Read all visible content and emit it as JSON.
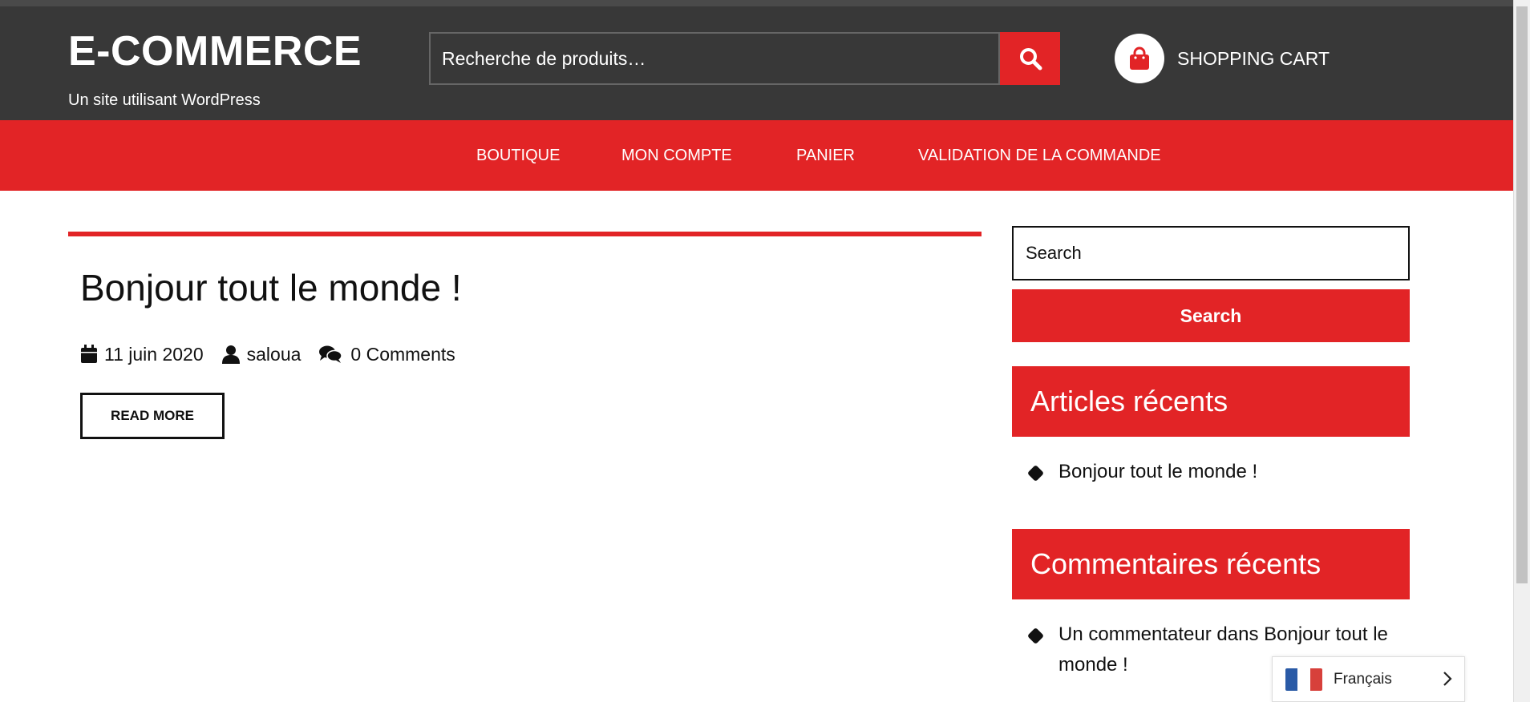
{
  "header": {
    "site_title": "E-COMMERCE",
    "tagline": "Un site utilisant WordPress",
    "search_placeholder": "Recherche de produits…",
    "search_icon": "search-icon",
    "cart_icon": "shopping-bag-icon",
    "cart_label": "SHOPPING CART"
  },
  "nav": {
    "items": [
      {
        "label": "BOUTIQUE"
      },
      {
        "label": "MON COMPTE"
      },
      {
        "label": "PANIER"
      },
      {
        "label": "VALIDATION DE LA COMMANDE"
      }
    ]
  },
  "post": {
    "title": "Bonjour tout le monde !",
    "date": "11 juin 2020",
    "author": "saloua",
    "comments": "0 Comments",
    "read_more": "READ MORE"
  },
  "sidebar": {
    "search_placeholder": "Search",
    "search_button": "Search",
    "recent_posts_title": "Articles récents",
    "recent_posts": [
      "Bonjour tout le monde !"
    ],
    "recent_comments_title": "Commentaires récents",
    "recent_comments": [
      "Un commentateur dans Bonjour tout le monde !"
    ]
  },
  "language": {
    "label": "Français",
    "flag": "france-flag-icon"
  },
  "colors": {
    "accent": "#e22426",
    "header_bg": "#383838",
    "text": "#111111"
  }
}
